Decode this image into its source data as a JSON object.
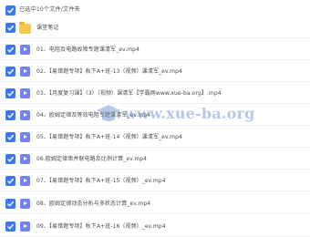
{
  "header": {
    "selection_text": "已选中10个文件/文件夹"
  },
  "items": [
    {
      "type": "folder",
      "name": "课堂笔记"
    },
    {
      "type": "video",
      "name": "01、电阻及电路故障专题课清军_ev.mp4"
    },
    {
      "type": "video",
      "name": "02、【易错题专项】秋下A+班-13（视频）课清军_ev.mp4"
    },
    {
      "type": "video",
      "name": "03、【月度复习课】（3）（视频）课清军【学霸网www.xue-ba.org】.mp4"
    },
    {
      "type": "video",
      "name": "04、欧姆定律及等效电阻专题课清军_ev.mp4"
    },
    {
      "type": "video",
      "name": "05、【易错题专项】秋下A+班-14（视频）课清军_ev.mp4"
    },
    {
      "type": "video",
      "name": "06.欧姆定律串并联电路及比例计算_ev.mp4"
    },
    {
      "type": "video",
      "name": "07、【易错题专项】秋下A+班-15（视频）_ev.mp4"
    },
    {
      "type": "video",
      "name": "08、欧姆定律动态分析与多状态计算_ev.mp4"
    },
    {
      "type": "video",
      "name": "09、【易错题专项】秋下A+班-16（视频）_ev.mp4"
    }
  ],
  "watermark": {
    "text": "www.xue-ba.org"
  },
  "colors": {
    "checkbox": "#3d78f2",
    "folder": "#f8c94a",
    "video_icon": "#7580f6"
  }
}
